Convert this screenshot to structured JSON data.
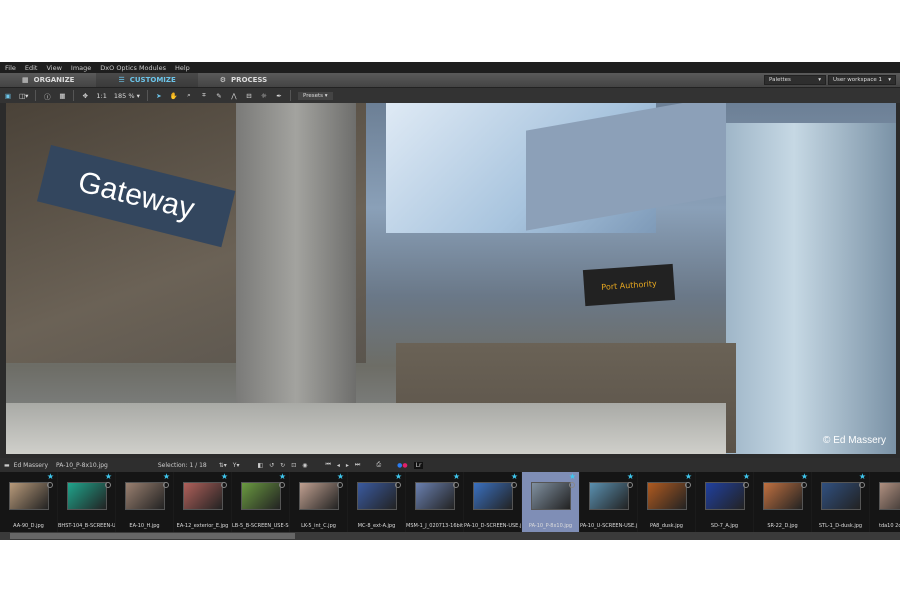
{
  "menu": [
    "File",
    "Edit",
    "View",
    "Image",
    "DxO Optics Modules",
    "Help"
  ],
  "tabs": [
    {
      "label": "ORGANIZE",
      "icon": "grid-icon"
    },
    {
      "label": "CUSTOMIZE",
      "icon": "sliders-icon",
      "active": true
    },
    {
      "label": "PROCESS",
      "icon": "gears-icon"
    }
  ],
  "palettes": "Palettes",
  "workspace": "User workspace 1",
  "toolbar": {
    "one_to_one": "1:1",
    "zoom": "185 %",
    "presets": "Presets"
  },
  "photo": {
    "sign": "Gateway",
    "display": "Port Authority",
    "copyright": "© Ed Massery"
  },
  "filmstrip": {
    "folder": "Ed Massery",
    "file": "PA-10_P-8x10.jpg",
    "selection": "Selection: 1 / 18",
    "lr": "Lr",
    "items": [
      {
        "name": "AA-90_D.jpg",
        "color": "#b89a7a"
      },
      {
        "name": "BHST-104_B-SCREEN-USE",
        "color": "#1fa58c"
      },
      {
        "name": "EA-10_H.jpg",
        "color": "#9a8070"
      },
      {
        "name": "EA-12_exterior_E.jpg",
        "color": "#b0605a"
      },
      {
        "name": "LB-5_B-SCREEN_USE-SCRE",
        "color": "#6a9a40"
      },
      {
        "name": "LK-5_int_C.jpg",
        "color": "#c0a090"
      },
      {
        "name": "MC-8_ext-A.jpg",
        "color": "#3a5aa0"
      },
      {
        "name": "MSM-1_J_020713-16bit.jpg",
        "color": "#6a80b0"
      },
      {
        "name": "PA-10_D-SCREEN-USE.jpg",
        "color": "#3a70c0"
      },
      {
        "name": "PA-10_P-8x10.jpg",
        "color": "#8090a0",
        "selected": true
      },
      {
        "name": "PA-10_U-SCREEN-USE.jpg",
        "color": "#5a90b0"
      },
      {
        "name": "PA8_dusk.jpg",
        "color": "#b05a20"
      },
      {
        "name": "SD-7_A.jpg",
        "color": "#2040a0"
      },
      {
        "name": "SR-22_D.jpg",
        "color": "#c07040"
      },
      {
        "name": "STL-1_D-dusk.jpg",
        "color": "#305080"
      },
      {
        "name": "tda10 2of2 C ©",
        "color": "#b09080"
      }
    ]
  }
}
